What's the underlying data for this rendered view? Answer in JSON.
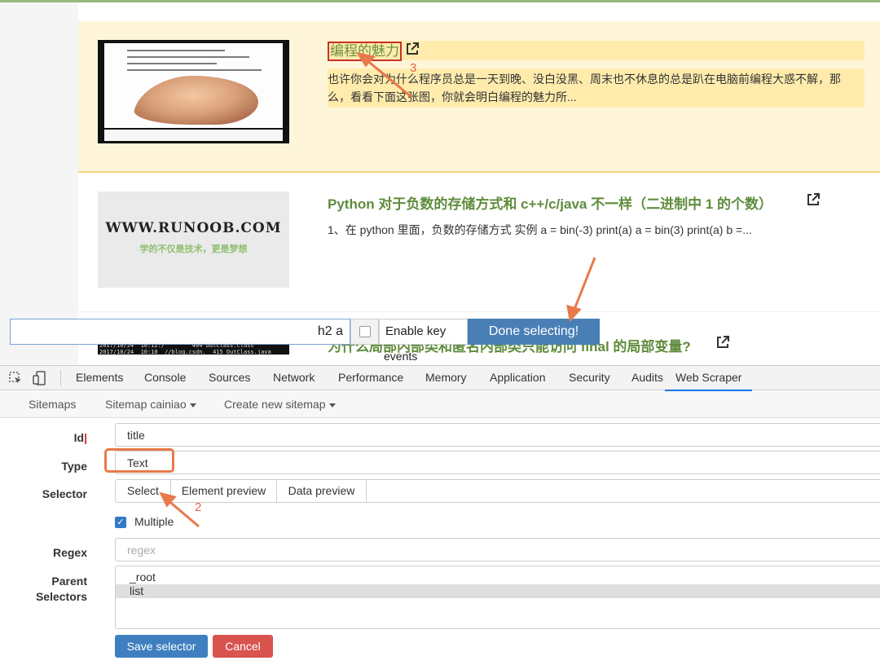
{
  "articles": [
    {
      "title": "编程的魅力",
      "description": "也许你会对为什么程序员总是一天到晚、没白没黑、周末也不休息的总是趴在电脑前编程大惑不解，那么，看看下面这张图，你就会明白编程的魅力所...",
      "selected": true
    },
    {
      "title": "Python 对于负数的存储方式和 c++/c/java 不一样（二进制中 1 的个数）",
      "description": "1、在 python 里面，负数的存储方式 实例 a = bin(-3) print(a)   a = bin(3) print(a)   b =...",
      "thumb_logo": "WWW.RUNOOB.COM",
      "thumb_sub": "学的不仅是技术，更是梦想"
    },
    {
      "title": "为什么局部内部类和匿名内部类只能访问 final 的局部变量?",
      "thumb_text": "2017/10/24  10:12:/        404 OutClass.class\n2017/10/24  10:10  //blog.csdn.  415 OutClass.java"
    }
  ],
  "selection_toolbar": {
    "selector_value": "h2 a",
    "enable_key_label": "Enable key",
    "done_label": "Done selecting!",
    "events_label": "events"
  },
  "devtools": {
    "tabs": [
      "Elements",
      "Console",
      "Sources",
      "Network",
      "Performance",
      "Memory",
      "Application",
      "Security",
      "Audits",
      "Web Scraper"
    ],
    "active_tab": "Web Scraper",
    "scraper_nav": {
      "sitemaps": "Sitemaps",
      "sitemap_current": "Sitemap cainiao",
      "create_new": "Create new sitemap"
    },
    "form": {
      "id_label": "Id",
      "id_value": "title",
      "type_label": "Type",
      "type_value": "Text",
      "selector_label": "Selector",
      "select_btn": "Select",
      "element_preview_btn": "Element preview",
      "data_preview_btn": "Data preview",
      "multiple_label": "Multiple",
      "multiple_checked": true,
      "regex_label": "Regex",
      "regex_placeholder": "regex",
      "parent_label_line1": "Parent",
      "parent_label_line2": "Selectors",
      "parent_options": [
        "_root",
        "list"
      ],
      "parent_selected": "list",
      "save_label": "Save selector",
      "cancel_label": "Cancel"
    }
  },
  "annotations": {
    "step1_label": "",
    "step2_label": "2",
    "step3_label": "3",
    "arrow_color": "#e8794a"
  },
  "colors": {
    "title_green": "#5f8c3c",
    "selected_bg": "#fff6da",
    "done_button": "#4a7fb6",
    "save_button": "#3f7fc0",
    "cancel_button": "#d9534f"
  }
}
